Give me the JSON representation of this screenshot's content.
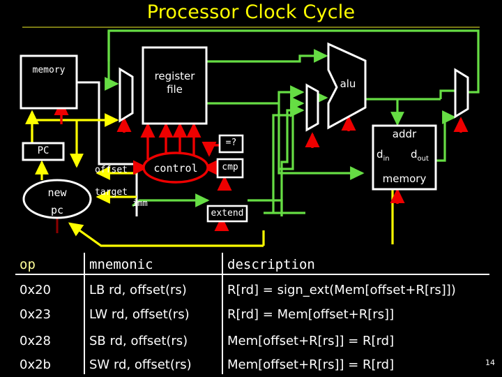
{
  "slide": {
    "title": "Processor Clock Cycle",
    "page_number": "14",
    "colors": {
      "background": "#000000",
      "title": "#ffff00",
      "title_rule": "#7a7a14",
      "white_wire": "#ffffff",
      "green_wire": "#66dd44",
      "yellow_wire": "#ffff00",
      "red_wire": "#ee0000",
      "dark_red": "#8b0000"
    }
  },
  "diagram": {
    "blocks": [
      {
        "id": "memory-instruction",
        "label": "memory"
      },
      {
        "id": "register-file",
        "label": "register file",
        "line1": "register",
        "line2": "file"
      },
      {
        "id": "alu",
        "label": "alu"
      },
      {
        "id": "pc",
        "label": "PC"
      },
      {
        "id": "new-pc",
        "label": "new pc",
        "line1": "new",
        "line2": "pc"
      },
      {
        "id": "control",
        "label": "control"
      },
      {
        "id": "equals-compare",
        "label": "=?"
      },
      {
        "id": "cmp",
        "label": "cmp"
      },
      {
        "id": "extend",
        "label": "extend"
      },
      {
        "id": "memory-data",
        "label": "memory",
        "addr": "addr",
        "d_in": "d",
        "d_in_sub": "in",
        "d_out": "d",
        "d_out_sub": "out"
      }
    ],
    "wire_labels": [
      {
        "id": "offset",
        "label": "offset"
      },
      {
        "id": "target",
        "label": "target"
      },
      {
        "id": "imm",
        "label": "imm"
      }
    ]
  },
  "table": {
    "headers": [
      "op",
      "mnemonic",
      "description"
    ],
    "rows": [
      {
        "op": "0x20",
        "mnemonic": "LB rd, offset(rs)",
        "description": "R[rd] = sign_ext(Mem[offset+R[rs]])"
      },
      {
        "op": "0x23",
        "mnemonic": "LW rd, offset(rs)",
        "description": "R[rd] = Mem[offset+R[rs]]"
      },
      {
        "op": "0x28",
        "mnemonic": "SB rd, offset(rs)",
        "description": "Mem[offset+R[rs]] = R[rd]"
      },
      {
        "op": "0x2b",
        "mnemonic": "SW rd, offset(rs)",
        "description": "Mem[offset+R[rs]] =  R[rd]"
      }
    ]
  }
}
